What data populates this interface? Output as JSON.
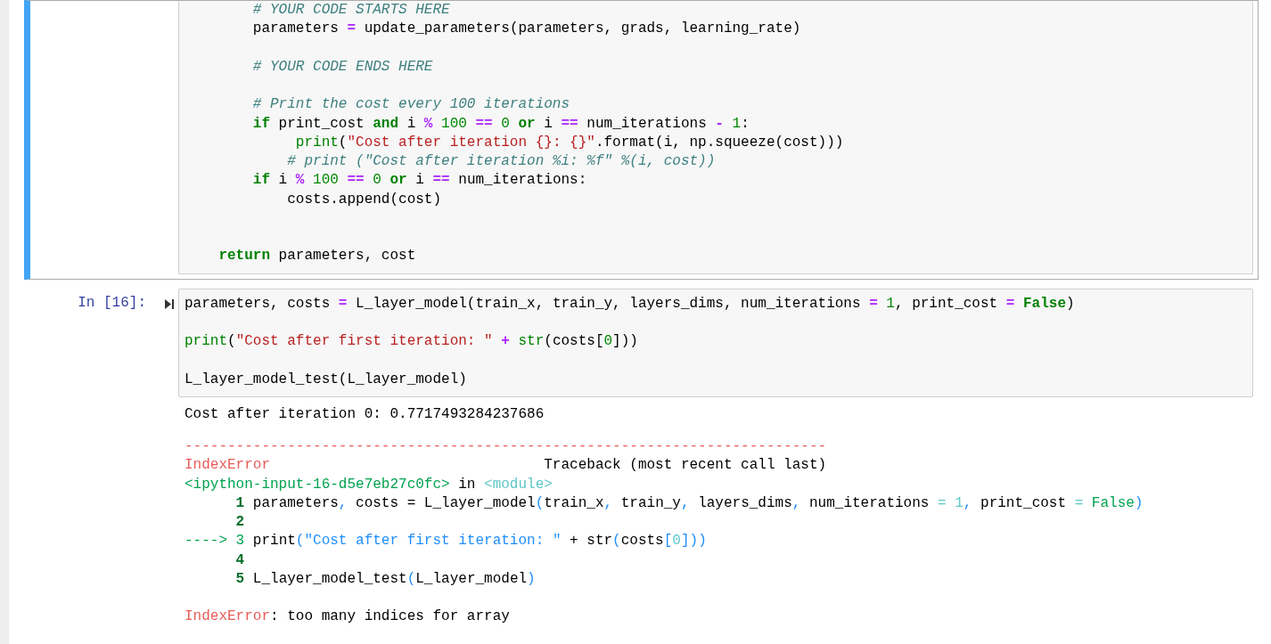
{
  "cells": [
    {
      "selected": true,
      "lines": [
        {
          "kind": "code",
          "tokens": [
            {
              "kind": "comment",
              "text": "        # YOUR CODE STARTS HERE"
            }
          ]
        },
        {
          "kind": "code",
          "tokens": [
            {
              "kind": "plain",
              "text": "        parameters "
            },
            {
              "kind": "op",
              "text": "="
            },
            {
              "kind": "plain",
              "text": " update_parameters(parameters, grads, learning_rate)"
            }
          ]
        },
        {
          "kind": "blank"
        },
        {
          "kind": "code",
          "tokens": [
            {
              "kind": "comment",
              "text": "        # YOUR CODE ENDS HERE"
            }
          ]
        },
        {
          "kind": "blank"
        },
        {
          "kind": "code",
          "tokens": [
            {
              "kind": "comment",
              "text": "        # Print the cost every 100 iterations"
            }
          ]
        },
        {
          "kind": "code",
          "tokens": [
            {
              "kind": "keyword",
              "text": "        if"
            },
            {
              "kind": "plain",
              "text": " print_cost "
            },
            {
              "kind": "keyword",
              "text": "and"
            },
            {
              "kind": "plain",
              "text": " i "
            },
            {
              "kind": "op",
              "text": "%"
            },
            {
              "kind": "number",
              "text": " 100"
            },
            {
              "kind": "op",
              "text": " =="
            },
            {
              "kind": "number",
              "text": " 0"
            },
            {
              "kind": "keyword",
              "text": " or"
            },
            {
              "kind": "plain",
              "text": " i "
            },
            {
              "kind": "op",
              "text": "=="
            },
            {
              "kind": "plain",
              "text": " num_iterations "
            },
            {
              "kind": "op",
              "text": "-"
            },
            {
              "kind": "number",
              "text": " 1"
            },
            {
              "kind": "plain",
              "text": ":"
            }
          ]
        },
        {
          "kind": "code",
          "tokens": [
            {
              "kind": "builtin",
              "text": "             print"
            },
            {
              "kind": "plain",
              "text": "("
            },
            {
              "kind": "string",
              "text": "\"Cost after iteration {}: {}\""
            },
            {
              "kind": "plain",
              "text": ".format(i, np.squeeze(cost)))"
            }
          ]
        },
        {
          "kind": "code",
          "tokens": [
            {
              "kind": "comment",
              "text": "            # print (\"Cost after iteration %i: %f\" %(i, cost))"
            }
          ]
        },
        {
          "kind": "code",
          "tokens": [
            {
              "kind": "keyword",
              "text": "        if"
            },
            {
              "kind": "plain",
              "text": " i "
            },
            {
              "kind": "op",
              "text": "%"
            },
            {
              "kind": "number",
              "text": " 100"
            },
            {
              "kind": "op",
              "text": " =="
            },
            {
              "kind": "number",
              "text": " 0"
            },
            {
              "kind": "keyword",
              "text": " or"
            },
            {
              "kind": "plain",
              "text": " i "
            },
            {
              "kind": "op",
              "text": "=="
            },
            {
              "kind": "plain",
              "text": " num_iterations:"
            }
          ]
        },
        {
          "kind": "code",
          "tokens": [
            {
              "kind": "plain",
              "text": "            costs.append(cost)"
            }
          ]
        },
        {
          "kind": "blank"
        },
        {
          "kind": "blank"
        },
        {
          "kind": "code",
          "tokens": [
            {
              "kind": "keyword",
              "text": "    return"
            },
            {
              "kind": "plain",
              "text": " parameters, cost"
            }
          ]
        }
      ]
    },
    {
      "selected": false,
      "prompt": "In [16]:",
      "lines": [
        {
          "kind": "code",
          "tokens": [
            {
              "kind": "plain",
              "text": "parameters, costs "
            },
            {
              "kind": "op",
              "text": "="
            },
            {
              "kind": "plain",
              "text": " L_layer_model(train_x, train_y, layers_dims, num_iterations "
            },
            {
              "kind": "op",
              "text": "="
            },
            {
              "kind": "number",
              "text": " 1"
            },
            {
              "kind": "plain",
              "text": ", print_cost "
            },
            {
              "kind": "op",
              "text": "="
            },
            {
              "kind": "keyword",
              "text": " False"
            },
            {
              "kind": "plain",
              "text": ")"
            }
          ]
        },
        {
          "kind": "blank"
        },
        {
          "kind": "code",
          "tokens": [
            {
              "kind": "builtin",
              "text": "print"
            },
            {
              "kind": "plain",
              "text": "("
            },
            {
              "kind": "string",
              "text": "\"Cost after first iteration: \""
            },
            {
              "kind": "op",
              "text": " +"
            },
            {
              "kind": "builtin",
              "text": " str"
            },
            {
              "kind": "plain",
              "text": "(costs["
            },
            {
              "kind": "number",
              "text": "0"
            },
            {
              "kind": "plain",
              "text": "]))"
            }
          ]
        },
        {
          "kind": "blank"
        },
        {
          "kind": "code",
          "tokens": [
            {
              "kind": "plain",
              "text": "L_layer_model_test(L_layer_model)"
            }
          ]
        }
      ],
      "outputs": [
        {
          "kind": "stdout",
          "lines": [
            {
              "kind": "code",
              "tokens": [
                {
                  "kind": "plain",
                  "text": "Cost after iteration 0: 0.7717493284237686"
                }
              ]
            }
          ]
        },
        {
          "kind": "error",
          "lines": [
            {
              "kind": "code",
              "tokens": [
                {
                  "kind": "red",
                  "text": "---------------------------------------------------------------------------"
                }
              ]
            },
            {
              "kind": "code",
              "tokens": [
                {
                  "kind": "red",
                  "text": "IndexError"
                },
                {
                  "kind": "plain",
                  "text": "                                Traceback (most recent call last)"
                }
              ]
            },
            {
              "kind": "code",
              "tokens": [
                {
                  "kind": "green",
                  "text": "<ipython-input-16-d5e7eb27c0fc>"
                },
                {
                  "kind": "plain",
                  "text": " in "
                },
                {
                  "kind": "cyan",
                  "text": "<module>"
                }
              ]
            },
            {
              "kind": "code",
              "tokens": [
                {
                  "kind": "lineno",
                  "text": "      1"
                },
                {
                  "kind": "plain",
                  "text": " parameters"
                },
                {
                  "kind": "blue",
                  "text": ","
                },
                {
                  "kind": "plain",
                  "text": " costs = L_layer_model"
                },
                {
                  "kind": "blue",
                  "text": "("
                },
                {
                  "kind": "plain",
                  "text": "train_x"
                },
                {
                  "kind": "blue",
                  "text": ","
                },
                {
                  "kind": "plain",
                  "text": " train_y"
                },
                {
                  "kind": "blue",
                  "text": ","
                },
                {
                  "kind": "plain",
                  "text": " layers_dims"
                },
                {
                  "kind": "blue",
                  "text": ","
                },
                {
                  "kind": "plain",
                  "text": " num_iterations "
                },
                {
                  "kind": "cyan",
                  "text": "="
                },
                {
                  "kind": "cyan",
                  "text": " 1"
                },
                {
                  "kind": "blue",
                  "text": ","
                },
                {
                  "kind": "plain",
                  "text": " print_cost "
                },
                {
                  "kind": "cyan",
                  "text": "="
                },
                {
                  "kind": "green",
                  "text": " False"
                },
                {
                  "kind": "blue",
                  "text": ")"
                }
              ]
            },
            {
              "kind": "code",
              "tokens": [
                {
                  "kind": "lineno",
                  "text": "      2"
                }
              ]
            },
            {
              "kind": "code",
              "tokens": [
                {
                  "kind": "green",
                  "text": "----> 3"
                },
                {
                  "kind": "plain",
                  "text": " print"
                },
                {
                  "kind": "blue",
                  "text": "(\"Cost after first iteration: \""
                },
                {
                  "kind": "plain",
                  "text": " + str"
                },
                {
                  "kind": "blue",
                  "text": "("
                },
                {
                  "kind": "plain",
                  "text": "costs"
                },
                {
                  "kind": "blue",
                  "text": "["
                },
                {
                  "kind": "cyan",
                  "text": "0"
                },
                {
                  "kind": "blue",
                  "text": "]))"
                }
              ]
            },
            {
              "kind": "code",
              "tokens": [
                {
                  "kind": "lineno",
                  "text": "      4"
                }
              ]
            },
            {
              "kind": "code",
              "tokens": [
                {
                  "kind": "lineno",
                  "text": "      5"
                },
                {
                  "kind": "plain",
                  "text": " L_layer_model_test"
                },
                {
                  "kind": "blue",
                  "text": "("
                },
                {
                  "kind": "plain",
                  "text": "L_layer_model"
                },
                {
                  "kind": "blue",
                  "text": ")"
                }
              ]
            },
            {
              "kind": "blank"
            },
            {
              "kind": "code",
              "tokens": [
                {
                  "kind": "red",
                  "text": "IndexError"
                },
                {
                  "kind": "plain",
                  "text": ": too many indices for array"
                }
              ]
            }
          ]
        }
      ]
    }
  ]
}
